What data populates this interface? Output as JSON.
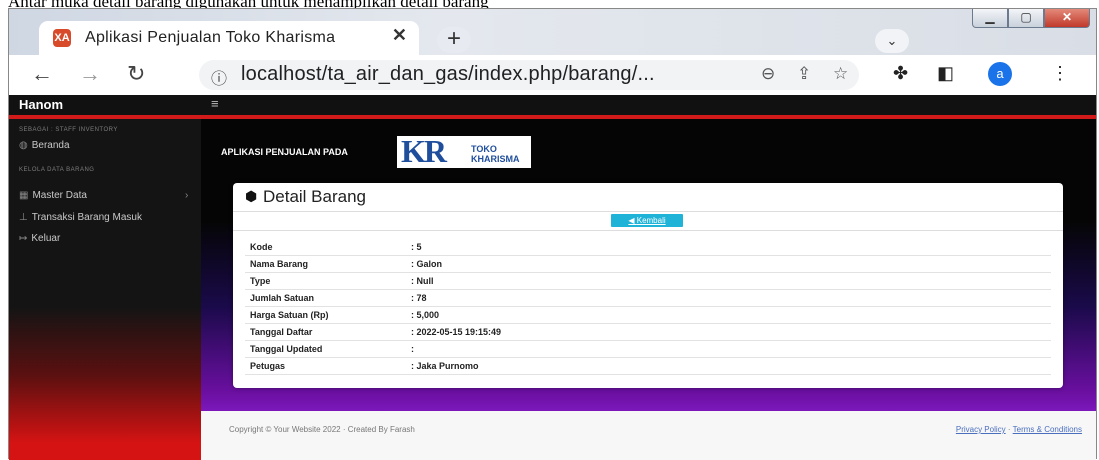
{
  "caption": "Antar muka detail barang digunakan untuk menampilkan detail barang",
  "browser": {
    "tab_title": "Aplikasi Penjualan Toko Kharisma",
    "tab_icon_text": "XA",
    "url": "localhost/ta_air_dan_gas/index.php/barang/...",
    "avatar_letter": "a"
  },
  "app": {
    "brand": "Hanom",
    "toggle_glyph": "≡",
    "sidebar": {
      "section1": "SEBAGAI : STAFF INVENTORY",
      "beranda": "Beranda",
      "section2": "KELOLA DATA BARANG",
      "master_data": "Master Data",
      "transaksi": "Transaksi Barang Masuk",
      "keluar": "Keluar"
    },
    "app_title": "APLIKASI PENJUALAN PADA",
    "logo": {
      "mark": "KR",
      "line1": "TOKO",
      "line2": "KHARISMA"
    },
    "card_title": "Detail Barang",
    "back_button": "Kembali",
    "details": [
      {
        "label": "Kode",
        "value": ": 5"
      },
      {
        "label": "Nama Barang",
        "value": ": Galon"
      },
      {
        "label": "Type",
        "value": ": Null"
      },
      {
        "label": "Jumlah Satuan",
        "value": ": 78"
      },
      {
        "label": "Harga Satuan (Rp)",
        "value": ": 5,000"
      },
      {
        "label": "Tanggal Daftar",
        "value": ": 2022-05-15 19:15:49"
      },
      {
        "label": "Tanggal Updated",
        "value": ":"
      },
      {
        "label": "Petugas",
        "value": ": Jaka Purnomo"
      }
    ],
    "footer": {
      "copyright": "Copyright © Your Website 2022 · Created By Farash",
      "privacy": "Privacy Policy",
      "separator": "·",
      "terms": "Terms & Conditions"
    }
  }
}
